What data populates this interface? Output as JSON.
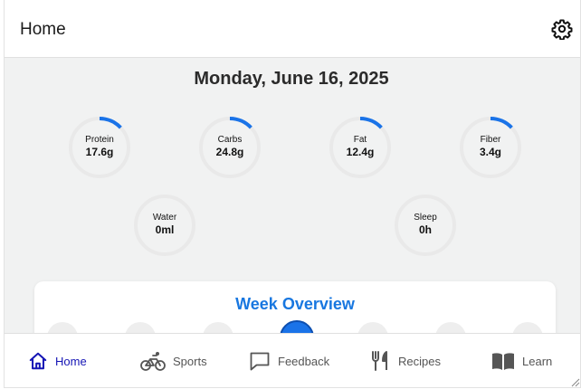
{
  "header": {
    "title": "Home",
    "settings_icon": "gear-icon"
  },
  "date": "Monday, June 16, 2025",
  "colors": {
    "accent": "#1a73e8",
    "nav_active": "#1515b5",
    "ring_track": "#e9e9e9",
    "ring_progress": "#1a73e8"
  },
  "nutrients": [
    {
      "label": "Protein",
      "value": "17.6g",
      "progress": 0.13
    },
    {
      "label": "Carbs",
      "value": "24.8g",
      "progress": 0.13
    },
    {
      "label": "Fat",
      "value": "12.4g",
      "progress": 0.13
    },
    {
      "label": "Fiber",
      "value": "3.4g",
      "progress": 0.13
    }
  ],
  "extras": [
    {
      "label": "Water",
      "value": "0ml",
      "progress": 0
    },
    {
      "label": "Sleep",
      "value": "0h",
      "progress": 0
    }
  ],
  "week": {
    "title": "Week Overview",
    "active_day_index": 3
  },
  "nav": [
    {
      "label": "Home",
      "icon": "home-icon",
      "active": true
    },
    {
      "label": "Sports",
      "icon": "bicycle-icon",
      "active": false
    },
    {
      "label": "Feedback",
      "icon": "message-icon",
      "active": false
    },
    {
      "label": "Recipes",
      "icon": "fork-knife-icon",
      "active": false
    },
    {
      "label": "Learn",
      "icon": "book-icon",
      "active": false
    }
  ]
}
